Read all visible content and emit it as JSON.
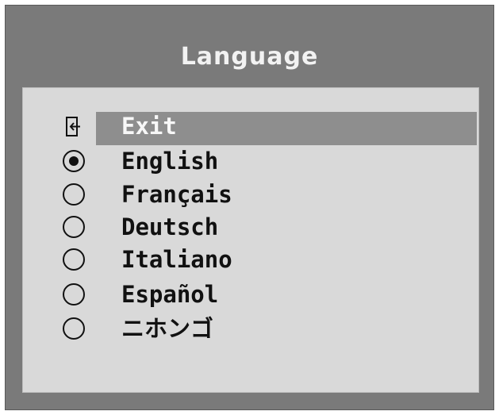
{
  "dialog": {
    "title": "Language"
  },
  "menu": {
    "exit_label": "Exit",
    "exit_icon": "exit-icon",
    "selected_item": "Exit",
    "languages": [
      {
        "label": "English",
        "checked": true
      },
      {
        "label": "Français",
        "checked": false
      },
      {
        "label": "Deutsch",
        "checked": false
      },
      {
        "label": "Italiano",
        "checked": false
      },
      {
        "label": "Español",
        "checked": false
      },
      {
        "label": "ニホンゴ",
        "checked": false
      }
    ]
  },
  "colors": {
    "frame": "#7a7a7a",
    "panel": "#d9d9d9",
    "highlight": "#8e8e8e",
    "text": "#111111",
    "title_text": "#f2f2f2"
  }
}
